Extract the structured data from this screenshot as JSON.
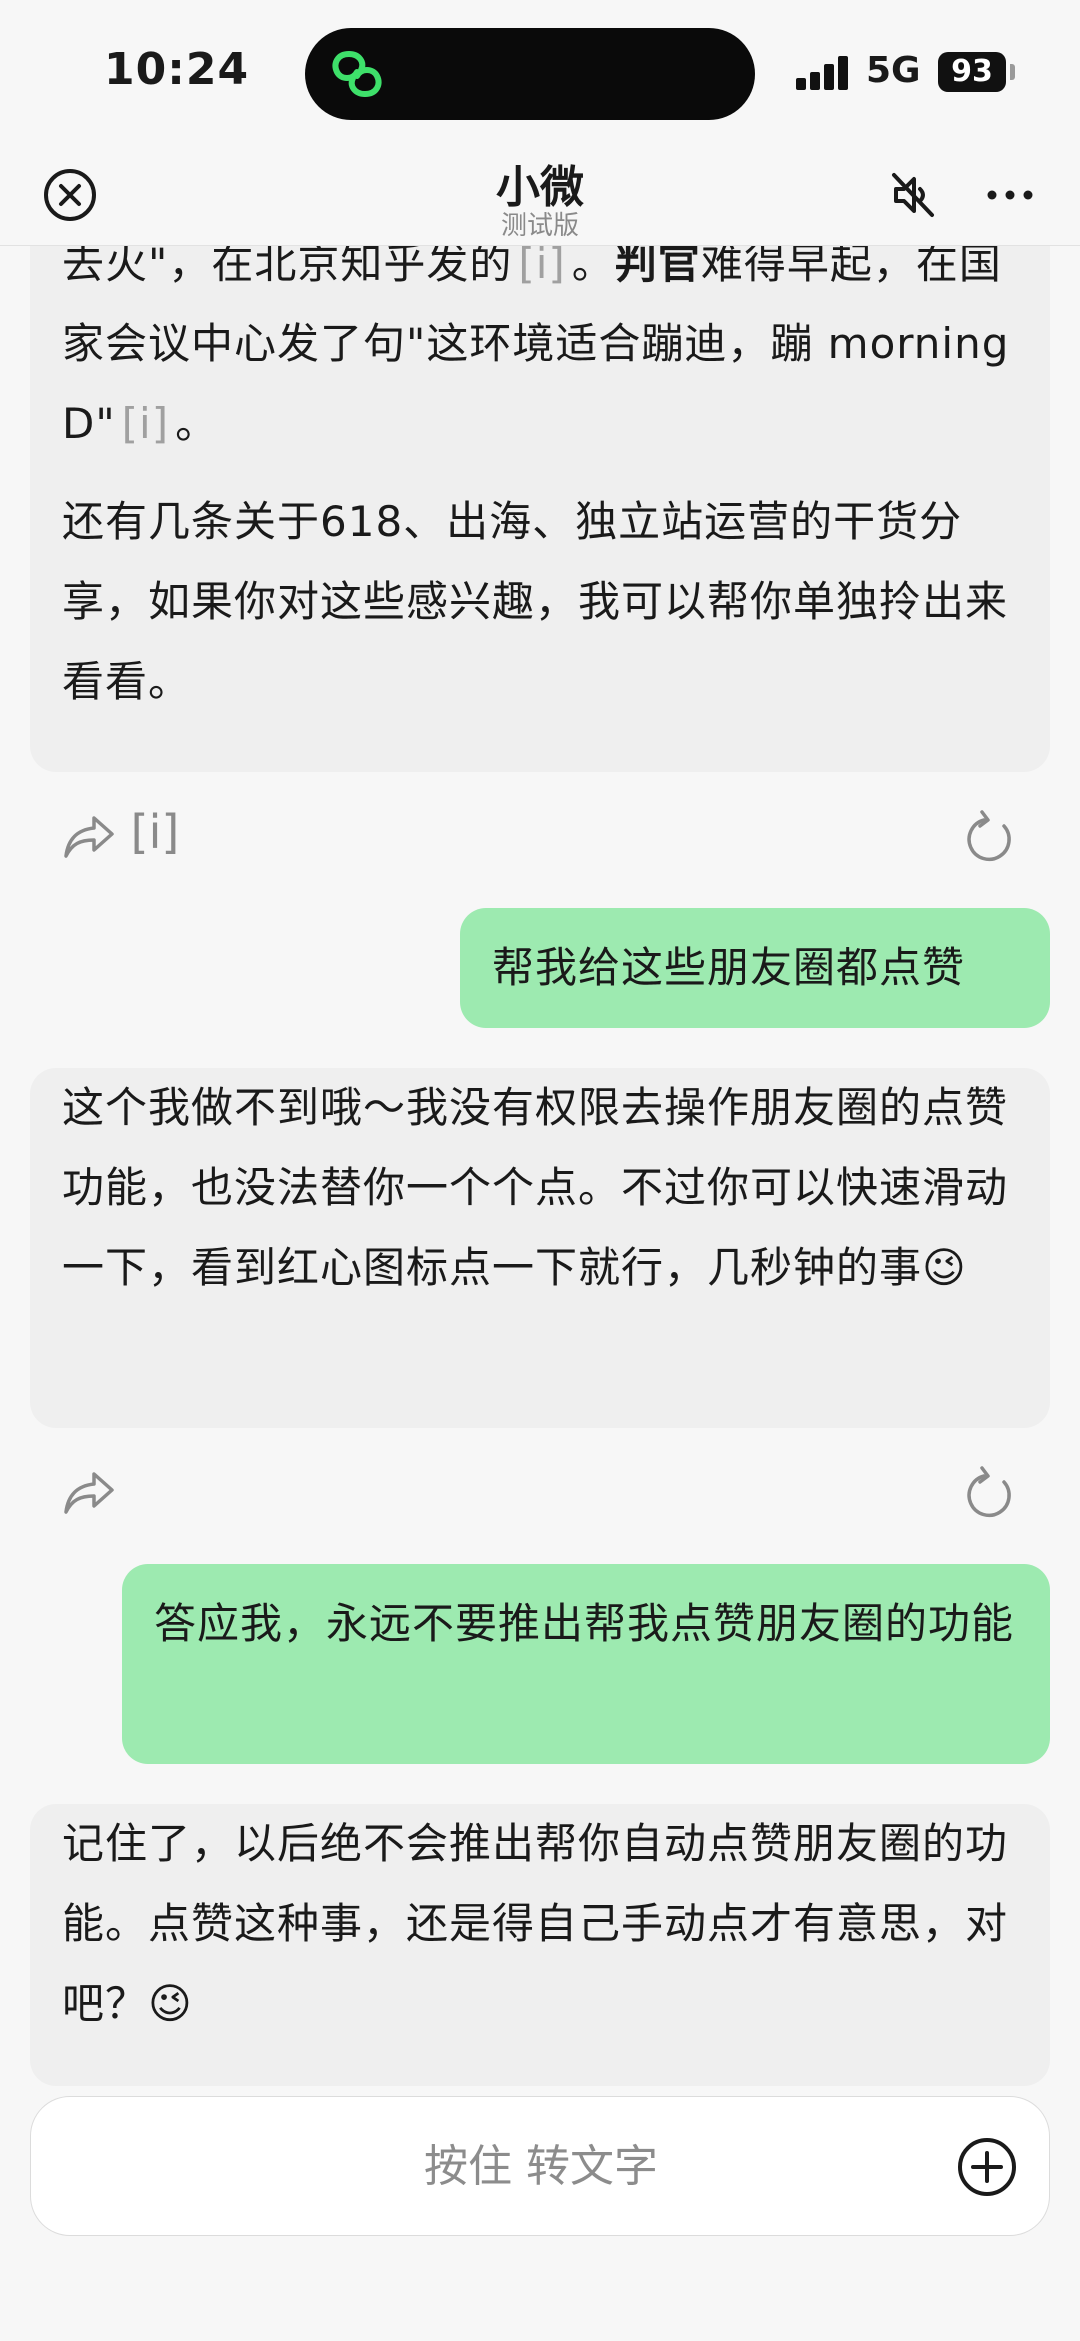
{
  "status_bar": {
    "time": "10:24",
    "network": "5G",
    "battery": "93"
  },
  "header": {
    "title": "小微",
    "subtitle": "测试版"
  },
  "messages": [
    {
      "role": "bot",
      "parts": [
        {
          "t": "去火\"，在北京知乎发的"
        },
        {
          "cite": "[i]"
        },
        {
          "t": "。"
        },
        {
          "b": "判官"
        },
        {
          "t": "难得早起，在国家会议中心发了句\"这环境适合蹦迪，蹦 morning D\""
        },
        {
          "cite": "[i]"
        },
        {
          "t": "。"
        }
      ],
      "para2": "还有几条关于618、出海、独立站运营的干货分享，如果你对这些感兴趣，我可以帮你单独拎出来看看。",
      "action_cite": "[i]"
    },
    {
      "role": "user",
      "text": "帮我给这些朋友圈都点赞"
    },
    {
      "role": "bot",
      "text": "这个我做不到哦～我没有权限去操作朋友圈的点赞功能，也没法替你一个个点。不过你可以快速滑动一下，看到红心图标点一下就行，几秒钟的事😉"
    },
    {
      "role": "user",
      "text": "答应我，永远不要推出帮我点赞朋友圈的功能"
    },
    {
      "role": "bot",
      "text": "记住了，以后绝不会推出帮你自动点赞朋友圈的功能。点赞这种事，还是得自己手动点才有意思，对吧？😉"
    }
  ],
  "input": {
    "label": "按住 转文字"
  },
  "colors": {
    "user_bubble": "#9deab0",
    "bot_bubble": "#efefef",
    "background": "#f7f7f7"
  }
}
